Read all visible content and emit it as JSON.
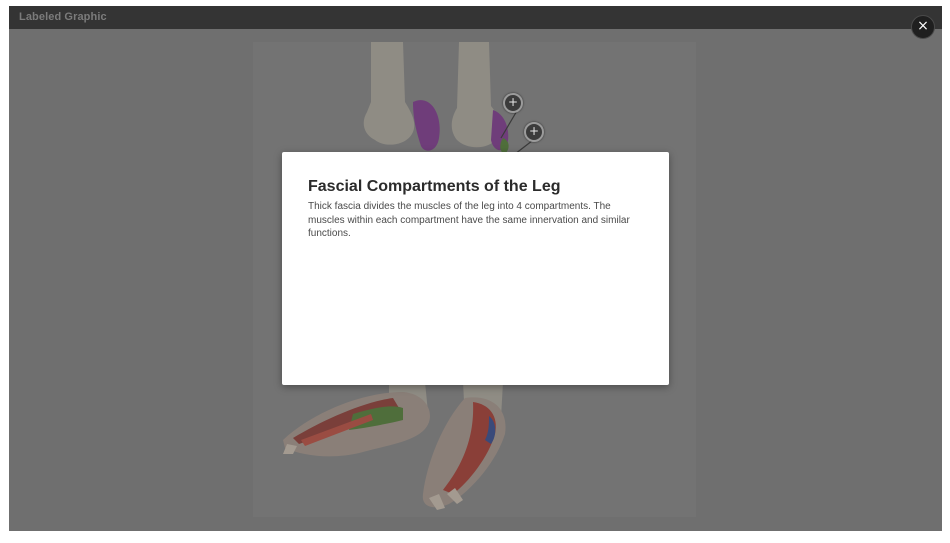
{
  "window": {
    "title": "Labeled Graphic"
  },
  "graphic": {
    "hotspots": [
      {
        "label": "+",
        "icon": "plus-icon"
      },
      {
        "label": "+",
        "icon": "plus-icon"
      }
    ]
  },
  "close_button": {
    "label": "×",
    "icon": "close-icon"
  },
  "modal": {
    "heading": "Fascial Compartments of the Leg",
    "body": "Thick fascia divides the muscles of the leg into 4 compartments. The muscles within each compartment have the same innervation and similar functions."
  },
  "colors": {
    "overlay": "#6f6f6f",
    "titlebar": "#343434",
    "modal_bg": "#ffffff",
    "heading": "#2b2b2b"
  }
}
